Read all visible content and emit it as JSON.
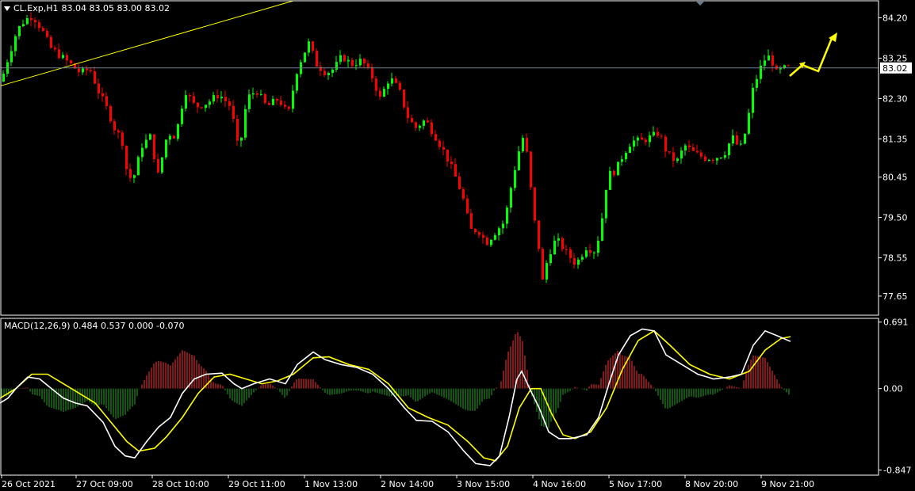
{
  "header": {
    "symbol": "CL.Exp,H1",
    "ohlc": "83.04 83.05 83.00 83.02"
  },
  "indicator": {
    "label": "MACD(12,26,9) 0.484 0.537 0.000 -0.070"
  },
  "colors": {
    "background": "#000000",
    "frame": "#ffffff",
    "bull_candle": "#00ff00",
    "bear_candle": "#ff0000",
    "trendline": "#ffff00",
    "arrow": "#ffff00",
    "price_line": "#708090",
    "macd_line": "#ffffff",
    "signal_line": "#ffff00",
    "hist_pos": "#ff3333",
    "hist_neg": "#22aa22"
  },
  "chart_data": [
    {
      "type": "candlestick",
      "title": "CL.Exp,H1",
      "ylim": [
        77.2,
        84.6
      ],
      "y_ticks": [
        "84.20",
        "83.25",
        "82.30",
        "81.35",
        "80.45",
        "79.50",
        "78.55",
        "77.65"
      ],
      "current_price": "83.02",
      "x_tick_labels": [
        "26 Oct 2021",
        "27 Oct 09:00",
        "28 Oct 10:00",
        "29 Oct 11:00",
        "1 Nov 13:00",
        "2 Nov 14:00",
        "3 Nov 15:00",
        "4 Nov 16:00",
        "5 Nov 17:00",
        "8 Nov 20:00",
        "9 Nov 21:00"
      ],
      "close_path": [
        [
          0,
          82.7
        ],
        [
          8,
          83.2
        ],
        [
          20,
          83.9
        ],
        [
          30,
          84.15
        ],
        [
          40,
          84.25
        ],
        [
          52,
          83.9
        ],
        [
          62,
          83.5
        ],
        [
          75,
          83.3
        ],
        [
          88,
          83.1
        ],
        [
          100,
          82.9
        ],
        [
          112,
          83.0
        ],
        [
          122,
          82.5
        ],
        [
          135,
          82.0
        ],
        [
          145,
          81.5
        ],
        [
          152,
          81.4
        ],
        [
          160,
          80.4
        ],
        [
          168,
          80.5
        ],
        [
          178,
          81.2
        ],
        [
          188,
          81.4
        ],
        [
          198,
          80.5
        ],
        [
          210,
          81.5
        ],
        [
          220,
          81.4
        ],
        [
          232,
          82.5
        ],
        [
          245,
          82.1
        ],
        [
          260,
          82.2
        ],
        [
          275,
          82.4
        ],
        [
          290,
          82.1
        ],
        [
          300,
          81.0
        ],
        [
          310,
          82.3
        ],
        [
          322,
          82.5
        ],
        [
          335,
          82.1
        ],
        [
          350,
          82.3
        ],
        [
          362,
          81.9
        ],
        [
          372,
          82.9
        ],
        [
          380,
          83.3
        ],
        [
          388,
          83.6
        ],
        [
          398,
          83.1
        ],
        [
          410,
          82.9
        ],
        [
          420,
          83.0
        ],
        [
          430,
          83.3
        ],
        [
          442,
          83.1
        ],
        [
          455,
          83.2
        ],
        [
          468,
          82.8
        ],
        [
          478,
          82.3
        ],
        [
          490,
          82.8
        ],
        [
          502,
          82.5
        ],
        [
          512,
          81.9
        ],
        [
          522,
          81.6
        ],
        [
          535,
          81.8
        ],
        [
          548,
          81.4
        ],
        [
          560,
          81.0
        ],
        [
          572,
          80.5
        ],
        [
          582,
          80.0
        ],
        [
          592,
          79.2
        ],
        [
          602,
          79.2
        ],
        [
          612,
          78.9
        ],
        [
          625,
          79.2
        ],
        [
          635,
          79.4
        ],
        [
          645,
          80.4
        ],
        [
          652,
          81.0
        ],
        [
          660,
          81.5
        ],
        [
          666,
          80.5
        ],
        [
          672,
          79.5
        ],
        [
          678,
          78.8
        ],
        [
          683,
          78.0
        ],
        [
          690,
          78.6
        ],
        [
          700,
          79.0
        ],
        [
          712,
          78.7
        ],
        [
          725,
          78.4
        ],
        [
          738,
          78.8
        ],
        [
          750,
          78.7
        ],
        [
          758,
          79.5
        ],
        [
          765,
          80.5
        ],
        [
          775,
          80.6
        ],
        [
          785,
          81.0
        ],
        [
          795,
          81.3
        ],
        [
          808,
          81.3
        ],
        [
          820,
          81.4
        ],
        [
          830,
          81.5
        ],
        [
          840,
          81.0
        ],
        [
          852,
          80.8
        ],
        [
          862,
          81.2
        ],
        [
          875,
          81.0
        ],
        [
          888,
          80.9
        ],
        [
          900,
          80.9
        ],
        [
          912,
          81.0
        ],
        [
          922,
          81.4
        ],
        [
          932,
          81.1
        ],
        [
          940,
          81.6
        ],
        [
          948,
          82.5
        ],
        [
          955,
          82.9
        ],
        [
          962,
          83.2
        ],
        [
          970,
          83.3
        ],
        [
          978,
          82.9
        ],
        [
          985,
          83.0
        ],
        [
          992,
          83.02
        ]
      ],
      "trendline": {
        "from": [
          "26 Oct 2021",
          82.8
        ],
        "to": [
          "27 Oct 09:00+",
          84.6
        ]
      },
      "price_line": 83.02,
      "projection_arrow": "yellow zigzag up arrow"
    },
    {
      "type": "line",
      "title": "MACD(12,26,9) 0.484 0.537 0.000 -0.070",
      "ylim": [
        -0.9,
        0.73
      ],
      "y_ticks": [
        "0.691",
        "0.00",
        "-0.847"
      ],
      "series": [
        {
          "name": "MACD",
          "values_path": [
            [
              0,
              -0.15
            ],
            [
              10,
              -0.1
            ],
            [
              20,
              0.0
            ],
            [
              35,
              0.12
            ],
            [
              50,
              0.1
            ],
            [
              65,
              0.0
            ],
            [
              80,
              -0.1
            ],
            [
              95,
              -0.15
            ],
            [
              110,
              -0.18
            ],
            [
              130,
              -0.35
            ],
            [
              145,
              -0.6
            ],
            [
              158,
              -0.7
            ],
            [
              170,
              -0.72
            ],
            [
              185,
              -0.55
            ],
            [
              200,
              -0.4
            ],
            [
              215,
              -0.3
            ],
            [
              230,
              -0.05
            ],
            [
              245,
              0.1
            ],
            [
              260,
              0.15
            ],
            [
              280,
              0.16
            ],
            [
              295,
              0.05
            ],
            [
              305,
              0.0
            ],
            [
              320,
              0.05
            ],
            [
              340,
              0.1
            ],
            [
              360,
              0.05
            ],
            [
              375,
              0.25
            ],
            [
              395,
              0.38
            ],
            [
              410,
              0.3
            ],
            [
              430,
              0.25
            ],
            [
              450,
              0.22
            ],
            [
              470,
              0.15
            ],
            [
              490,
              0.0
            ],
            [
              510,
              -0.2
            ],
            [
              525,
              -0.33
            ],
            [
              545,
              -0.34
            ],
            [
              565,
              -0.45
            ],
            [
              585,
              -0.65
            ],
            [
              600,
              -0.78
            ],
            [
              618,
              -0.8
            ],
            [
              630,
              -0.7
            ],
            [
              642,
              -0.3
            ],
            [
              652,
              0.1
            ],
            [
              658,
              0.18
            ],
            [
              668,
              0.0
            ],
            [
              680,
              -0.2
            ],
            [
              692,
              -0.45
            ],
            [
              705,
              -0.52
            ],
            [
              720,
              -0.52
            ],
            [
              740,
              -0.48
            ],
            [
              755,
              -0.3
            ],
            [
              768,
              0.05
            ],
            [
              780,
              0.35
            ],
            [
              795,
              0.55
            ],
            [
              810,
              0.62
            ],
            [
              825,
              0.6
            ],
            [
              840,
              0.35
            ],
            [
              860,
              0.25
            ],
            [
              880,
              0.15
            ],
            [
              900,
              0.1
            ],
            [
              920,
              0.12
            ],
            [
              935,
              0.15
            ],
            [
              950,
              0.45
            ],
            [
              965,
              0.6
            ],
            [
              980,
              0.55
            ],
            [
              997,
              0.49
            ]
          ]
        },
        {
          "name": "Signal",
          "values_path": [
            [
              0,
              -0.1
            ],
            [
              20,
              0.0
            ],
            [
              40,
              0.15
            ],
            [
              60,
              0.15
            ],
            [
              80,
              0.05
            ],
            [
              100,
              -0.05
            ],
            [
              120,
              -0.15
            ],
            [
              140,
              -0.35
            ],
            [
              160,
              -0.55
            ],
            [
              175,
              -0.65
            ],
            [
              195,
              -0.62
            ],
            [
              210,
              -0.5
            ],
            [
              230,
              -0.3
            ],
            [
              250,
              -0.05
            ],
            [
              270,
              0.12
            ],
            [
              290,
              0.15
            ],
            [
              310,
              0.1
            ],
            [
              330,
              0.05
            ],
            [
              350,
              0.08
            ],
            [
              370,
              0.15
            ],
            [
              395,
              0.32
            ],
            [
              415,
              0.33
            ],
            [
              440,
              0.25
            ],
            [
              465,
              0.2
            ],
            [
              490,
              0.05
            ],
            [
              515,
              -0.2
            ],
            [
              540,
              -0.3
            ],
            [
              565,
              -0.38
            ],
            [
              590,
              -0.55
            ],
            [
              610,
              -0.72
            ],
            [
              625,
              -0.75
            ],
            [
              640,
              -0.6
            ],
            [
              655,
              -0.2
            ],
            [
              670,
              0.0
            ],
            [
              682,
              0.0
            ],
            [
              695,
              -0.25
            ],
            [
              710,
              -0.48
            ],
            [
              725,
              -0.52
            ],
            [
              745,
              -0.45
            ],
            [
              765,
              -0.2
            ],
            [
              785,
              0.2
            ],
            [
              805,
              0.5
            ],
            [
              825,
              0.6
            ],
            [
              845,
              0.45
            ],
            [
              870,
              0.25
            ],
            [
              895,
              0.15
            ],
            [
              920,
              0.1
            ],
            [
              945,
              0.18
            ],
            [
              965,
              0.4
            ],
            [
              985,
              0.52
            ],
            [
              997,
              0.54
            ]
          ]
        },
        {
          "name": "Histogram",
          "type": "bar"
        }
      ]
    }
  ]
}
